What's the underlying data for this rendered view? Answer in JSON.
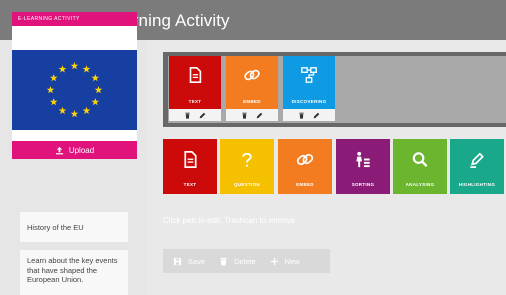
{
  "header": {
    "title": "Edit your e-Learning Activity"
  },
  "sidebar": {
    "card_label": "E-LEARNING ACTIVITY",
    "upload_label": "Upload",
    "title_text": "History of the EU",
    "description_text": "Learn about the key events that have shaped the European Union."
  },
  "placed_tiles": [
    {
      "label": "TEXT",
      "icon": "document-icon",
      "color": "#cc0a0a"
    },
    {
      "label": "EMBED",
      "icon": "link-icon",
      "color": "#f47c20"
    },
    {
      "label": "DISCOVERING",
      "icon": "network-icon",
      "color": "#0e9be4"
    }
  ],
  "library_tiles": [
    {
      "label": "TEXT",
      "icon": "document-icon",
      "color": "#cc0a0a"
    },
    {
      "label": "QUESTION",
      "icon": "question-icon",
      "color": "#f5c000"
    },
    {
      "label": "EMBED",
      "icon": "link-icon",
      "color": "#f47c20"
    },
    {
      "label": "SORTING",
      "icon": "sorting-icon",
      "color": "#8a1c78"
    },
    {
      "label": "ANALYSING",
      "icon": "magnifier-icon",
      "color": "#6bb52f"
    },
    {
      "label": "HIGHLIGHTING",
      "icon": "highlighter-icon",
      "color": "#1aa88a"
    }
  ],
  "hint": "Click pen to edit. Trashcan to remove.",
  "toolbar": {
    "save_label": "Save",
    "delete_label": "Delete",
    "new_label": "New"
  },
  "colors": {
    "accent": "#e0127c",
    "flag_blue": "#173ea1",
    "flag_star": "#ffd400"
  }
}
